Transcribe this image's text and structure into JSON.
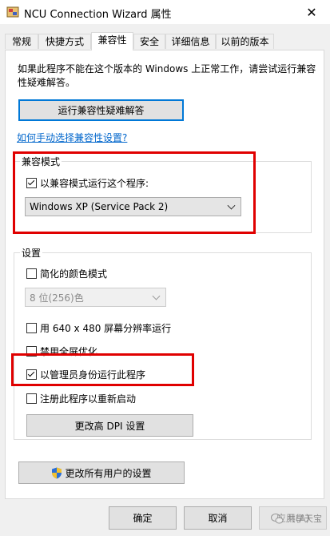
{
  "window": {
    "title": "NCU Connection Wizard 属性",
    "close_glyph": "✕"
  },
  "tabs": [
    {
      "label": "常规",
      "active": false
    },
    {
      "label": "快捷方式",
      "active": false
    },
    {
      "label": "兼容性",
      "active": true
    },
    {
      "label": "安全",
      "active": false
    },
    {
      "label": "详细信息",
      "active": false
    },
    {
      "label": "以前的版本",
      "active": false
    }
  ],
  "compat": {
    "intro": "如果此程序不能在这个版本的 Windows 上正常工作，请尝试运行兼容性疑难解答。",
    "troubleshoot_button": "运行兼容性疑难解答",
    "manual_link": "如何手动选择兼容性设置?",
    "mode_group": {
      "legend": "兼容模式",
      "checkbox_label": "以兼容模式运行这个程序:",
      "checked": true,
      "selected_os": "Windows XP (Service Pack 2)"
    },
    "settings_group": {
      "legend": "设置",
      "reduced_color_label": "简化的颜色模式",
      "reduced_color_checked": false,
      "color_depth_value": "8 位(256)色",
      "resolution_label": "用 640 x 480 屏幕分辨率运行",
      "resolution_checked": false,
      "fullscreen_label": "禁用全屏优化",
      "fullscreen_checked": false,
      "admin_label": "以管理员身份运行此程序",
      "admin_checked": true,
      "restart_label": "注册此程序以重新启动",
      "restart_checked": false,
      "dpi_button": "更改高 DPI 设置"
    },
    "all_users_button": "更改所有用户的设置"
  },
  "footer": {
    "ok": "确定",
    "cancel": "取消",
    "apply": "应用(A)"
  },
  "watermark": {
    "text": "共享天宝"
  },
  "colors": {
    "highlight": "#e00000",
    "focus_border": "#0078d7",
    "link": "#0066cc"
  }
}
